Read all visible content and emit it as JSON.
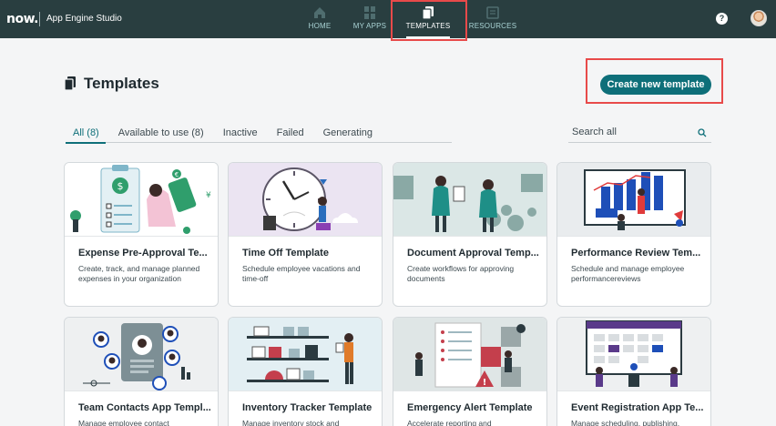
{
  "topbar": {
    "logo": "now.",
    "app_name": "App Engine Studio",
    "nav": [
      {
        "label": "HOME",
        "icon": "home-icon"
      },
      {
        "label": "MY APPS",
        "icon": "grid-icon"
      },
      {
        "label": "TEMPLATES",
        "icon": "templates-icon",
        "active": true
      },
      {
        "label": "RESOURCES",
        "icon": "book-icon"
      }
    ],
    "help": "?",
    "colors": {
      "bar": "#293e40",
      "nav_inactive": "#a9d3d4",
      "highlight": "#e84a4a"
    }
  },
  "header": {
    "title": "Templates",
    "create_button": "Create new template",
    "accent": "#0e6f79"
  },
  "tabs": [
    {
      "label": "All (8)",
      "active": true
    },
    {
      "label": "Available to use (8)"
    },
    {
      "label": "Inactive"
    },
    {
      "label": "Failed"
    },
    {
      "label": "Generating"
    }
  ],
  "search": {
    "placeholder": "Search all",
    "icon": "search-icon"
  },
  "cards": [
    {
      "title": "Expense Pre-Approval Te...",
      "description": "Create, track, and manage planned expenses in your organization",
      "bg": "#ffffff"
    },
    {
      "title": "Time Off Template",
      "description": "Schedule employee vacations and time-off",
      "bg": "#ebe4f2"
    },
    {
      "title": "Document Approval Temp...",
      "description": "Create workflows for approving documents",
      "bg": "#dbe7e6"
    },
    {
      "title": "Performance Review Tem...",
      "description": "Schedule and manage employee performancereviews",
      "bg": "#e9ecee"
    },
    {
      "title": "Team Contacts App Templ...",
      "description": "Manage employee contact",
      "bg": "#eef0f1"
    },
    {
      "title": "Inventory Tracker Template",
      "description": "Manage inventory stock and",
      "bg": "#e3eff3"
    },
    {
      "title": "Emergency Alert Template",
      "description": "Accelerate reporting and",
      "bg": "#dfe6e6"
    },
    {
      "title": "Event Registration App Te...",
      "description": "Manage scheduling, publishing,",
      "bg": "#eef0f1"
    }
  ]
}
